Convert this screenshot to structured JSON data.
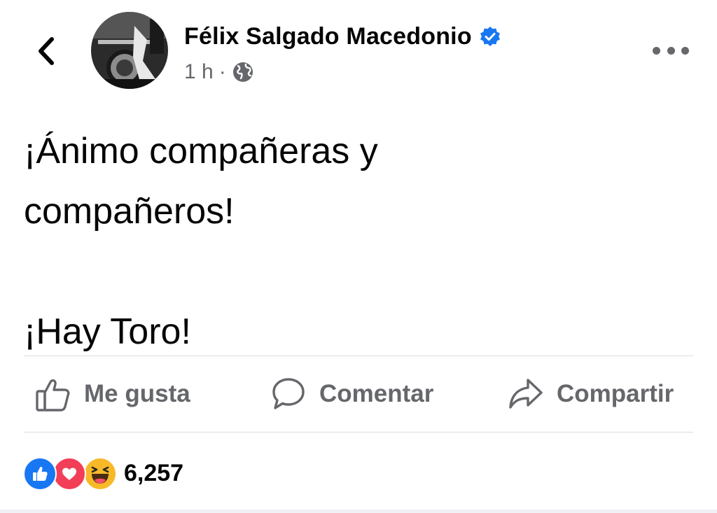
{
  "header": {
    "author_name": "Félix Salgado Macedonio",
    "timestamp": "1 h",
    "separator": "·",
    "privacy_icon": "globe-icon",
    "back_icon": "chevron-left-icon",
    "more_icon": "more-options-icon",
    "verified_icon": "verified-badge-icon",
    "verified_color": "#1877f2"
  },
  "post": {
    "line1": "¡Ánimo compañeras y",
    "line2": "compañeros!",
    "line3": "¡Hay Toro!"
  },
  "actions": {
    "like_label": "Me gusta",
    "comment_label": "Comentar",
    "share_label": "Compartir"
  },
  "reactions": {
    "icons": [
      "like-reaction-icon",
      "love-reaction-icon",
      "haha-reaction-icon"
    ],
    "count": "6,257",
    "colors": {
      "like": "#1877f2",
      "love": "#f33e58",
      "haha": "#f7b928"
    }
  }
}
